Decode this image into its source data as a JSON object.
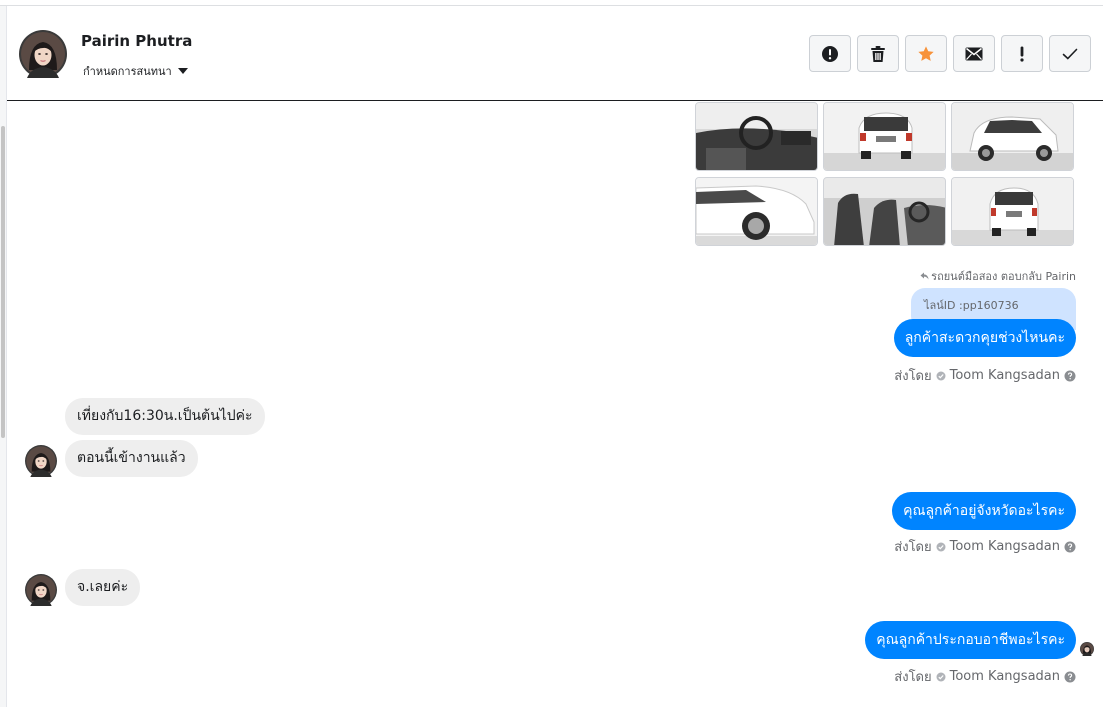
{
  "header": {
    "contact_name": "Pairin Phutra",
    "assign_label": "กำหนดการสนทนา",
    "toolbar": [
      {
        "name": "report-button",
        "icon": "alert-circle-icon"
      },
      {
        "name": "delete-button",
        "icon": "trash-icon"
      },
      {
        "name": "star-button",
        "icon": "star-icon",
        "color": "#f7923a"
      },
      {
        "name": "mark-unread-button",
        "icon": "envelope-icon"
      },
      {
        "name": "important-button",
        "icon": "exclamation-icon"
      },
      {
        "name": "done-button",
        "icon": "check-icon"
      }
    ]
  },
  "photos": [
    {
      "name": "car-interior-dashboard"
    },
    {
      "name": "car-rear-white"
    },
    {
      "name": "car-front-white"
    },
    {
      "name": "car-side-wheel"
    },
    {
      "name": "car-interior-seats"
    },
    {
      "name": "car-rear-white-2"
    }
  ],
  "reply_meta": "รถยนต์มือสอง ตอบกลับ Pairin",
  "reply_quote": "ไลน์ID :pp160736",
  "messages": [
    {
      "direction": "out",
      "text": "ลูกค้าสะดวกคุยช่วงไหนคะ",
      "sent_by_label": "ส่งโดย",
      "agent": "Toom Kangsadan"
    },
    {
      "direction": "in",
      "text": "เที่ยงกับ16:30น.เป็นต้นไปค่ะ"
    },
    {
      "direction": "in",
      "text": "ตอนนี้เข้างานแล้ว"
    },
    {
      "direction": "out",
      "text": "คุณลูกค้าอยู่จังหวัดอะไรคะ",
      "sent_by_label": "ส่งโดย",
      "agent": "Toom Kangsadan"
    },
    {
      "direction": "in",
      "text": "จ.เลยค่ะ"
    },
    {
      "direction": "out",
      "text": "คุณลูกค้าประกอบอาชีพอะไรคะ",
      "sent_by_label": "ส่งโดย",
      "agent": "Toom Kangsadan"
    }
  ],
  "colors": {
    "accent": "#0084ff",
    "incoming": "#eeeeee",
    "reply": "#cfe3ff",
    "star": "#f7923a"
  }
}
